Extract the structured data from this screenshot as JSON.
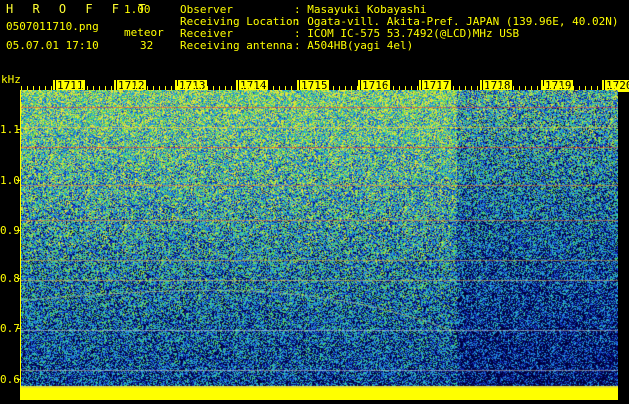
{
  "header": {
    "app_name": "H R O F F T",
    "version": "1.00",
    "filename": "0507011710.png",
    "datetime": "05.07.01 17:10",
    "meteor_label": "meteor",
    "meteor_count": "32"
  },
  "info": {
    "observer_label": "Observer",
    "observer_value": ": Masayuki Kobayashi",
    "location_label": "Receiving Location",
    "location_value": ": Ogata-vill. Akita-Pref. JAPAN (139.96E, 40.02N)",
    "receiver_label": "Receiver",
    "receiver_value": ": ICOM IC-575 53.7492(@LCD)MHz USB",
    "antenna_label": "Receiving antenna",
    "antenna_value": ": A504HB(yagi 4el)"
  },
  "axis": {
    "unit": "kHz",
    "y_ticks": [
      "1.1",
      "1.0",
      "0.9",
      "0.8",
      "0.7",
      "0.6"
    ],
    "time_labels": [
      "1711",
      "1712",
      "1713",
      "1714",
      "1715",
      "1716",
      "1717",
      "1718",
      "1719",
      "1720"
    ]
  },
  "colors": {
    "background": "#000000",
    "text": "#ffff00",
    "noise_low": "#0a1a8a",
    "noise_mid": "#1e8fd0",
    "noise_high": "#3fd07a",
    "carrier_red": "#ff3030"
  }
}
